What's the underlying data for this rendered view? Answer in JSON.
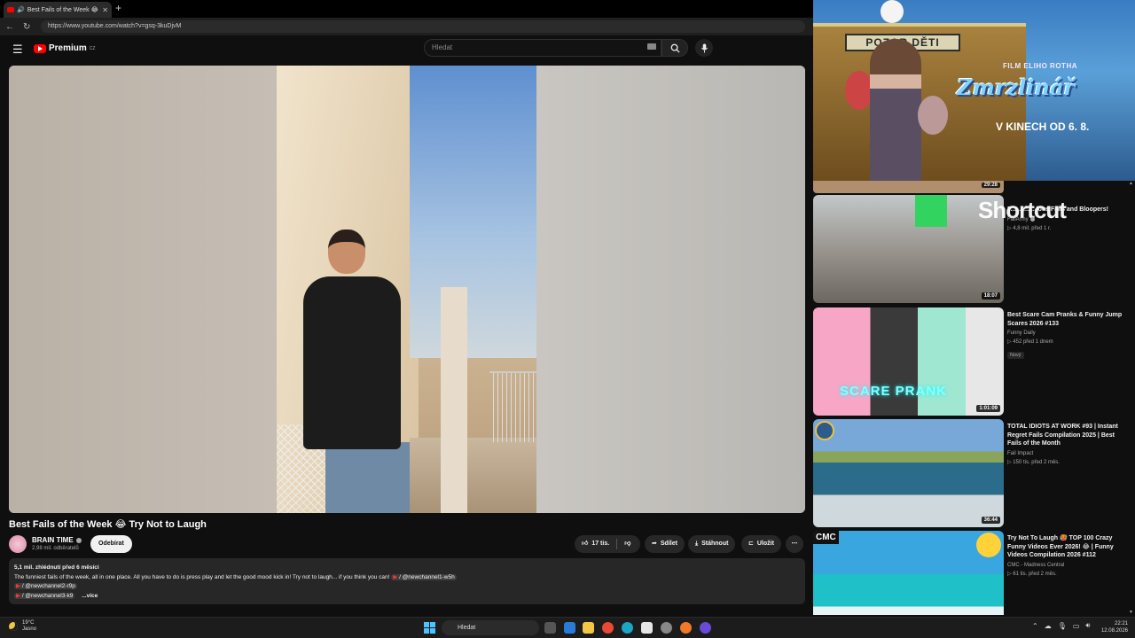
{
  "browser": {
    "tab_title": "Best Fails of the Week 😂 Try N",
    "tab_close": "✕",
    "new_tab": "+",
    "url": "https://www.youtube.com/watch?v=gsq-3kuDjvM"
  },
  "header": {
    "logo_text": "Premium",
    "logo_region": "CZ",
    "search_placeholder": "Hledat"
  },
  "video": {
    "title": "Best Fails of the Week 😂 Try Not to Laugh",
    "channel": "BRAIN TIME",
    "subscribers": "2,98 mil. odběratelů",
    "subscribe_label": "Odebírat",
    "likes": "17 tis.",
    "share_label": "Sdílet",
    "download_label": "Stáhnout",
    "save_label": "Uložit",
    "more_label": "⋯"
  },
  "description": {
    "meta": "5,1 mil. zhlédnutí  před 6 měsíci",
    "line1": "The funniest fails of the week, all in one place. All you have to do is press play and let the good mood kick in! Try not to laugh... if you think you can! ",
    "link1": "/ @newchannel1-w5h",
    "link2": "/ @newchannel2-r9p",
    "link3": "/ @newchannel3-k9",
    "more": "...více"
  },
  "ad": {
    "sign": "POZOR DĚTI",
    "brand": "FILM ELIHO ROTHA",
    "film_title": "Zmrzlinář",
    "release": "V KINECH OD 6. 8."
  },
  "recommendations": {
    "top_duration": "29:28",
    "shortcut_text": "Shortcut",
    "items": [
      {
        "title": "F... ... ... ...lous Fails and Bloopers!",
        "channel": "FailArmy",
        "verified": true,
        "views": "▷ 4,8 mil.  před 1 r.",
        "duration": "18:07",
        "badge": ""
      },
      {
        "title": "Best Scare Cam Pranks & Funny Jump Scares 2026 #133",
        "channel": "Funny Daily",
        "verified": false,
        "views": "▷ 452  před 1 dnem",
        "duration": "1:01:09",
        "badge": "Nový",
        "overlay": "SCARE PRANK"
      },
      {
        "title": "TOTAL IDIOTS AT WORK #93 | Instant Regret Fails Compilation 2025 | Best Fails of the Month",
        "channel": "Fail Impact",
        "verified": false,
        "views": "▷ 150 tis.  před 2 měs.",
        "duration": "36:44",
        "badge": ""
      },
      {
        "title": "Try Not To Laugh 🥵 TOP 100 Crazy Funny Videos Ever 2026! 😂 | Funny Videos Compilation 2026 #112",
        "channel": "CMC - Madness Central",
        "verified": false,
        "views": "▷ 61 tis.  před 2 měs.",
        "duration": "",
        "badge": "",
        "overlay": "CMC"
      }
    ]
  },
  "taskbar": {
    "temp": "19°C",
    "weather": "Jasno",
    "search": "Hledat",
    "time": "22:21",
    "date": "12.08.2026"
  },
  "colors": {
    "youtube_red": "#ff0000",
    "background": "#0f0f0f",
    "pill": "#272727"
  }
}
